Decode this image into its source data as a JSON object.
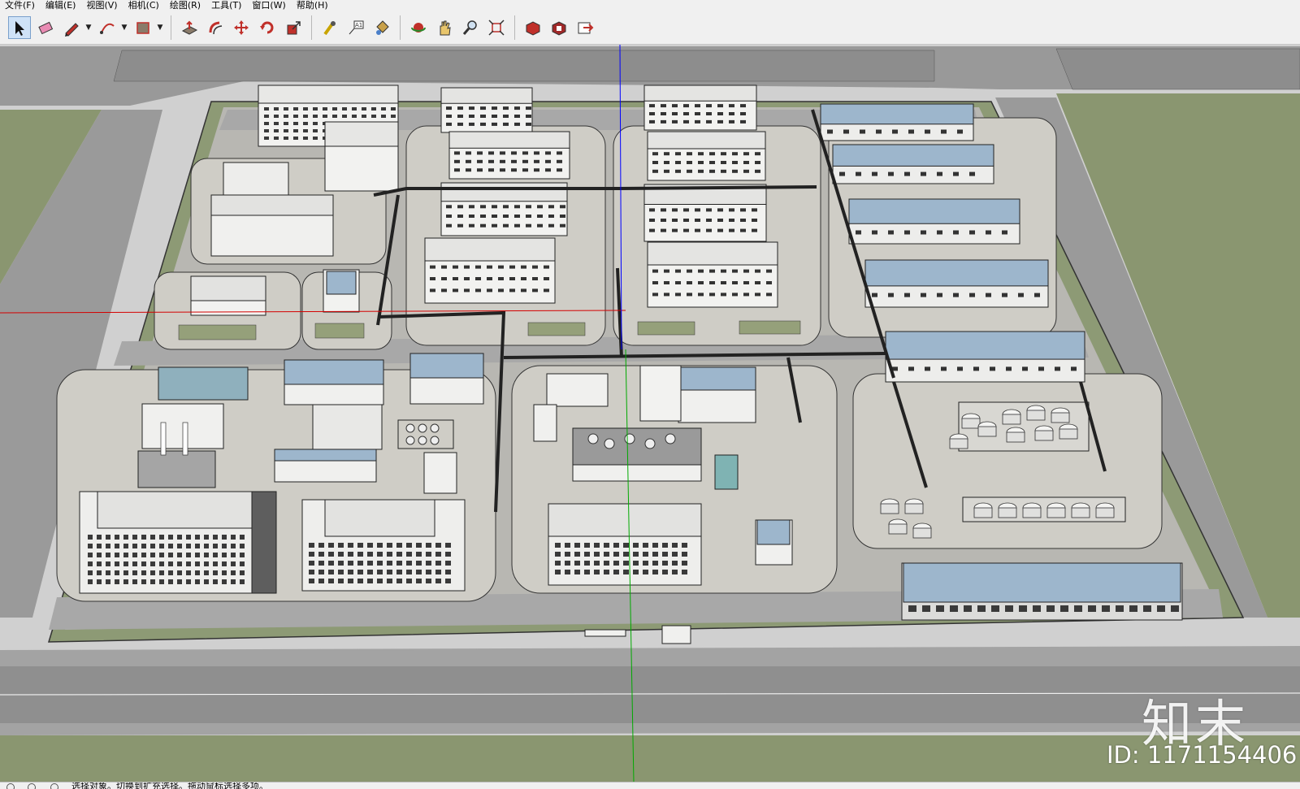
{
  "menu": [
    "文件(F)",
    "编辑(E)",
    "视图(V)",
    "相机(C)",
    "绘图(R)",
    "工具(T)",
    "窗口(W)",
    "帮助(H)"
  ],
  "toolbar": {
    "tools": [
      {
        "id": "select",
        "icon": "select-arrow-icon",
        "active": true
      },
      {
        "id": "eraser",
        "icon": "eraser-icon"
      },
      {
        "id": "pencil",
        "icon": "pencil-icon",
        "dropdown": true
      },
      {
        "id": "arc",
        "icon": "arc-icon",
        "dropdown": true
      },
      {
        "id": "rectangle",
        "icon": "rectangle-icon",
        "dropdown": true
      },
      {
        "id": "push-pull",
        "icon": "push-pull-icon"
      },
      {
        "id": "offset",
        "icon": "offset-icon"
      },
      {
        "id": "move",
        "icon": "move-icon"
      },
      {
        "id": "rotate",
        "icon": "rotate-icon"
      },
      {
        "id": "scale",
        "icon": "scale-icon"
      },
      {
        "id": "tape-measure",
        "icon": "tape-measure-icon"
      },
      {
        "id": "text",
        "icon": "text-icon"
      },
      {
        "id": "paint-bucket",
        "icon": "paint-bucket-icon"
      },
      {
        "id": "orbit",
        "icon": "orbit-icon"
      },
      {
        "id": "pan",
        "icon": "pan-hand-icon"
      },
      {
        "id": "zoom",
        "icon": "zoom-icon"
      },
      {
        "id": "zoom-extents",
        "icon": "zoom-extents-icon"
      },
      {
        "id": "warehouse",
        "icon": "3d-warehouse-icon"
      },
      {
        "id": "extension-warehouse",
        "icon": "extension-warehouse-icon"
      },
      {
        "id": "share-model",
        "icon": "share-model-icon"
      }
    ]
  },
  "colors": {
    "road": "#9a9a9a",
    "grass": "#8a9670",
    "paving": "#cfcdc6",
    "roof_blue": "#9db6cc",
    "building_white": "#f2f2f0",
    "axis_red": "#d40000",
    "axis_green": "#00aa00",
    "axis_blue": "#0000ff"
  },
  "watermark": {
    "logo": "知末",
    "id": "ID: 1171154406"
  },
  "status": {
    "text": "选择对象。切换到扩充选择。拖动鼠标选择多项。"
  }
}
